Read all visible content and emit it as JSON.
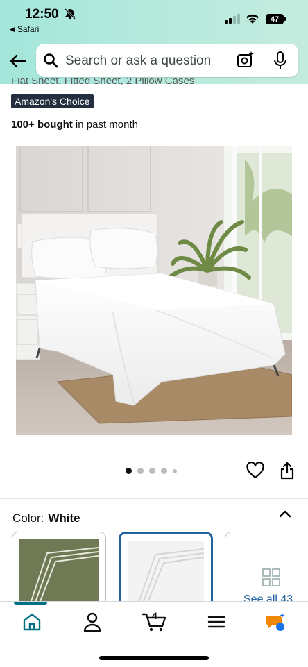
{
  "status_bar": {
    "time": "12:50",
    "back_app": "Safari",
    "battery": "47"
  },
  "search": {
    "placeholder": "Search or ask a question"
  },
  "product": {
    "partial_title": "Flat Sheet, Fitted Sheet, 2 Pillow Cases",
    "badge": "Amazon's Choice",
    "bought_bold": "100+ bought",
    "bought_rest": " in past month",
    "image_dots_total": 5,
    "image_dot_active": 1
  },
  "variation": {
    "label": "Color:",
    "value": "White",
    "swatches": [
      {
        "name": "Olive",
        "color": "#6f7a55"
      },
      {
        "name": "White",
        "color": "#f3f3f3",
        "selected": true
      }
    ],
    "see_all": "See all 43"
  },
  "tabbar": {
    "items": [
      "home-icon",
      "account-icon",
      "cart-icon",
      "menu-icon",
      "rufus-icon"
    ],
    "cart_count": "4",
    "accent": "#007185"
  }
}
